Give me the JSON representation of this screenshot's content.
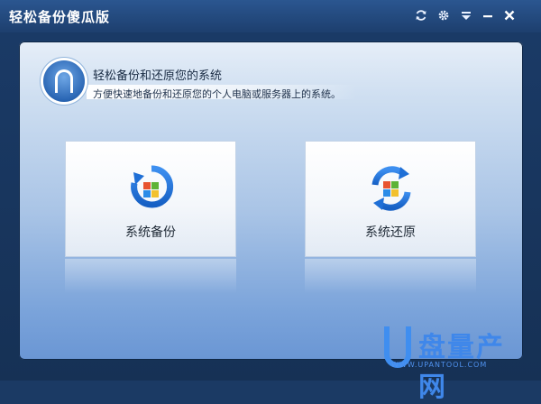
{
  "window": {
    "title": "轻松备份傻瓜版"
  },
  "titlebar_controls": [
    {
      "name": "refresh-icon"
    },
    {
      "name": "gear-icon"
    },
    {
      "name": "menu-dropdown-icon"
    },
    {
      "name": "minimize-icon"
    },
    {
      "name": "close-icon"
    }
  ],
  "header": {
    "title": "轻松备份和还原您的系统",
    "description": "方便快速地备份和还原您的个人电脑或服务器上的系统。",
    "icon": "door-arch-icon"
  },
  "actions": {
    "backup_label": "系统备份",
    "restore_label": "系统还原"
  },
  "watermark": {
    "letter": "U",
    "text": "盘量产网",
    "url": "WWW.UPANTOOL.COM"
  },
  "colors": {
    "titlebar": "#22477a",
    "accent_blue": "#2a74d8",
    "watermark_blue": "#3f87ea"
  }
}
